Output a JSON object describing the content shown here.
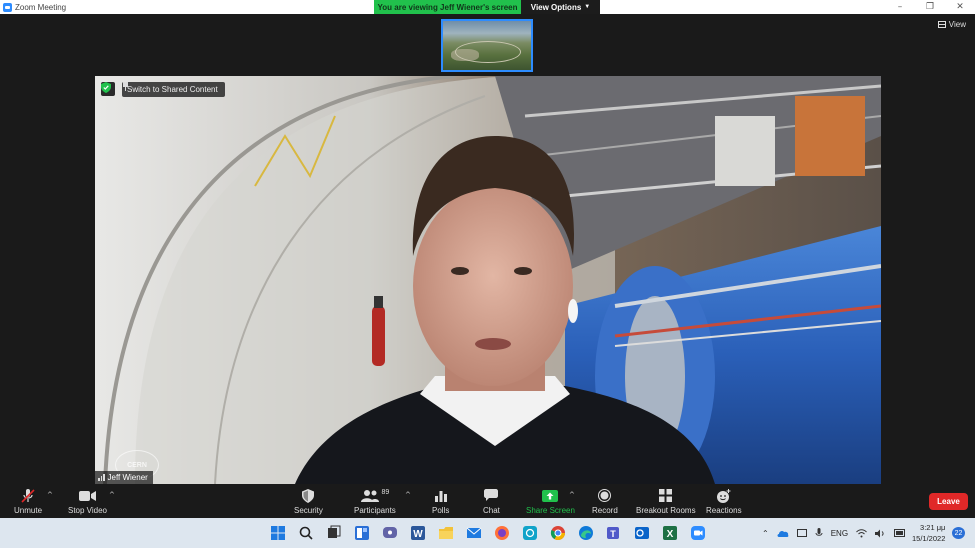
{
  "window": {
    "title": "Zoom Meeting"
  },
  "banner": {
    "viewing_text": "You are viewing Jeff Wiener's screen",
    "view_options_label": "View Options"
  },
  "view_button": {
    "label": "View"
  },
  "video": {
    "switch_label": "Switch to Shared Content",
    "participant_name": "Jeff Wiener",
    "logo_text": "CERN"
  },
  "toolbar": {
    "unmute": "Unmute",
    "stop_video": "Stop Video",
    "security": "Security",
    "participants": "Participants",
    "participants_count": "89",
    "polls": "Polls",
    "chat": "Chat",
    "share_screen": "Share Screen",
    "record": "Record",
    "breakout_rooms": "Breakout Rooms",
    "reactions": "Reactions",
    "leave": "Leave"
  },
  "taskbar": {
    "language": "ENG",
    "time": "3:21 μμ",
    "date": "15/1/2022",
    "notification_count": "22"
  },
  "colors": {
    "accent": "#2D8CFF",
    "banner_green": "#21c14c",
    "leave_red": "#e02828",
    "share_green": "#21c14c"
  }
}
